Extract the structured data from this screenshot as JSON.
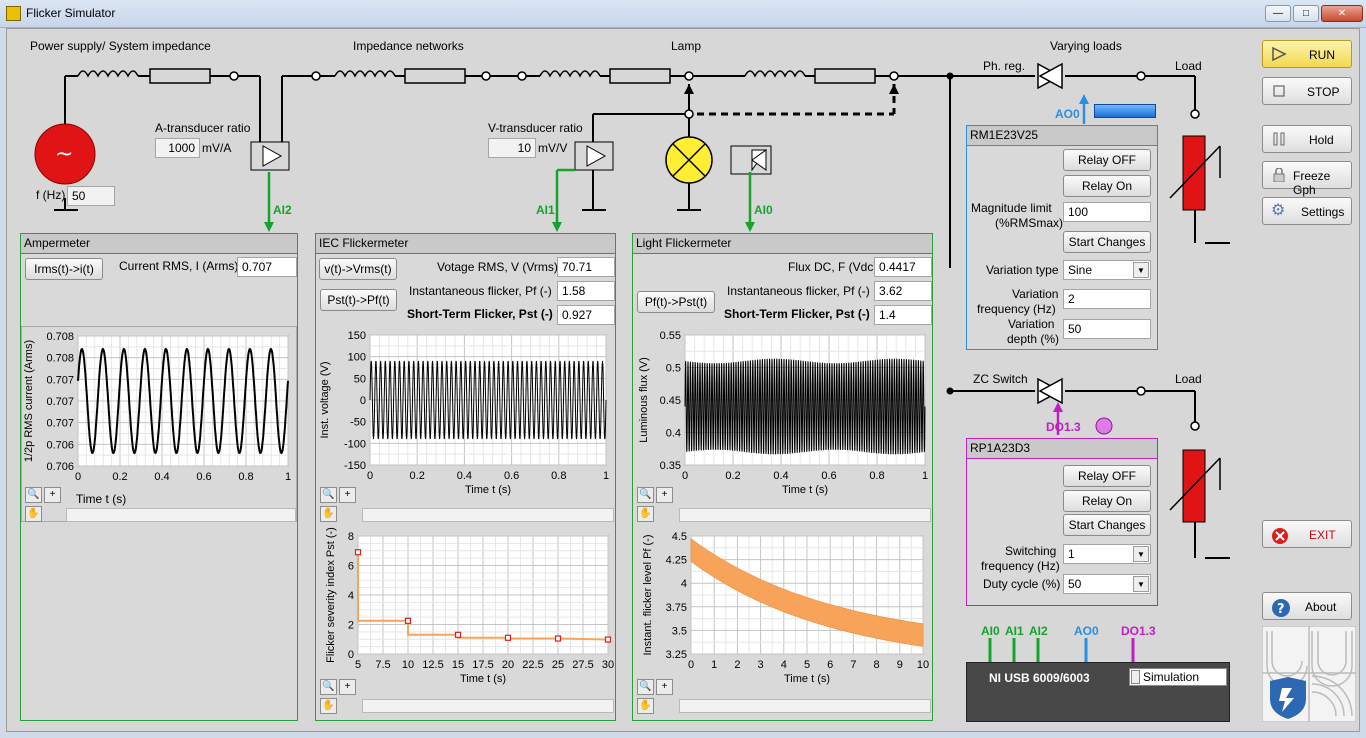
{
  "window": {
    "title": "Flicker Simulator"
  },
  "circuit": {
    "power_supply_label": "Power supply/ System impedance",
    "impedance_label": "Impedance networks",
    "lamp_label": "Lamp",
    "varying_loads_label": "Varying loads",
    "ph_reg_label": "Ph. reg.",
    "zc_switch_label": "ZC Switch",
    "load_label_1": "Load",
    "load_label_2": "Load",
    "f_label": "f (Hz)",
    "f_value": "50",
    "a_transducer_label": "A-transducer ratio",
    "a_transducer_value": "1000",
    "a_transducer_unit": "mV/A",
    "v_transducer_label": "V-transducer ratio",
    "v_transducer_value": "10",
    "v_transducer_unit": "mV/V",
    "ai2": "AI2",
    "ai1": "AI1",
    "ai0": "AI0",
    "ao0": "AO0",
    "do13": "DO1.3"
  },
  "ampermeter": {
    "title": "Ampermeter",
    "button": "Irms(t)->i(t)",
    "current_label": "Current RMS, I (Arms)",
    "current_value": "0.707",
    "chart": {
      "ylabel": "1/2p RMS current (Arms)",
      "xlabel": "Time t (s)",
      "yticks": [
        "0.708",
        "0.708",
        "0.707",
        "0.707",
        "0.707",
        "0.706",
        "0.706"
      ],
      "xticks": [
        "0",
        "0.2",
        "0.4",
        "0.6",
        "0.8",
        "1"
      ]
    }
  },
  "iec": {
    "title": "IEC Flickermeter",
    "button1": "v(t)->Vrms(t)",
    "button2": "Pst(t)->Pf(t)",
    "vrms_label": "Votage RMS, V (Vrms)",
    "vrms_value": "70.71",
    "pf_label": "Instantaneous flicker, Pf (-)",
    "pf_value": "1.58",
    "pst_label": "Short-Term Flicker, Pst (-)",
    "pst_value": "0.927",
    "chart1": {
      "ylabel": "Inst. voltage  (V)",
      "xlabel": "Time t (s)",
      "yticks": [
        "150",
        "100",
        "50",
        "0",
        "-50",
        "-100",
        "-150"
      ],
      "xticks": [
        "0",
        "0.2",
        "0.4",
        "0.6",
        "0.8",
        "1"
      ]
    },
    "chart2": {
      "ylabel": "Flicker severity index Pst (-)",
      "xlabel": "Time t (s)",
      "yticks": [
        "8",
        "6",
        "4",
        "2",
        "0"
      ],
      "xticks": [
        "5",
        "7.5",
        "10",
        "12.5",
        "15",
        "17.5",
        "20",
        "22.5",
        "25",
        "27.5",
        "30"
      ]
    }
  },
  "light": {
    "title": "Light Flickermeter",
    "button": "Pf(t)->Pst(t)",
    "flux_label": "Flux DC, F (Vdc)",
    "flux_value": "0.4417",
    "pf_label": "Instantaneous flicker, Pf (-)",
    "pf_value": "3.62",
    "pst_label": "Short-Term Flicker, Pst (-)",
    "pst_value": "1.4",
    "chart1": {
      "ylabel": "Luminous flux (V)",
      "xlabel": "Time t (s)",
      "yticks": [
        "0.55",
        "0.5",
        "0.45",
        "0.4",
        "0.35"
      ],
      "xticks": [
        "0",
        "0.2",
        "0.4",
        "0.6",
        "0.8",
        "1"
      ]
    },
    "chart2": {
      "ylabel": "Instant. flicker level Pf (-)",
      "xlabel": "Time t (s)",
      "yticks": [
        "4.5",
        "4.25",
        "4",
        "3.75",
        "3.5",
        "3.25"
      ],
      "xticks": [
        "0",
        "1",
        "2",
        "3",
        "4",
        "5",
        "6",
        "7",
        "8",
        "9",
        "10"
      ]
    }
  },
  "rm": {
    "title": "RM1E23V25",
    "relay_off": "Relay OFF",
    "relay_on": "Relay On",
    "mag_label_1": "Magnitude limit",
    "mag_label_2": "(%RMSmax)",
    "mag_value": "100",
    "start_changes": "Start Changes",
    "var_type_label": "Variation type",
    "var_type_value": "Sine",
    "var_freq_label_1": "Variation",
    "var_freq_label_2": "frequency (Hz)",
    "var_freq_value": "2",
    "var_depth_label_1": "Variation",
    "var_depth_label_2": "depth (%)",
    "var_depth_value": "50"
  },
  "rp": {
    "title": "RP1A23D3",
    "relay_off": "Relay OFF",
    "relay_on": "Relay On",
    "start_changes": "Start Changes",
    "sw_freq_label_1": "Switching",
    "sw_freq_label_2": "frequency (Hz)",
    "sw_freq_value": "1",
    "duty_label": "Duty cycle (%)",
    "duty_value": "50"
  },
  "daq": {
    "device": "NI USB 6009/6003",
    "mode": "Simulation",
    "ai0": "AI0",
    "ai1": "AI1",
    "ai2": "AI2",
    "ao0": "AO0",
    "do13": "DO1.3"
  },
  "side": {
    "run": "RUN",
    "stop": "STOP",
    "hold": "Hold",
    "freeze": "Freeze Gph",
    "settings": "Settings",
    "exit": "EXIT",
    "about": "About"
  },
  "colors": {
    "green": "#17a22e",
    "blue": "#2b8fe0",
    "magenta": "#c020c0",
    "orange": "#f7a45a",
    "red": "#d81e1e"
  }
}
